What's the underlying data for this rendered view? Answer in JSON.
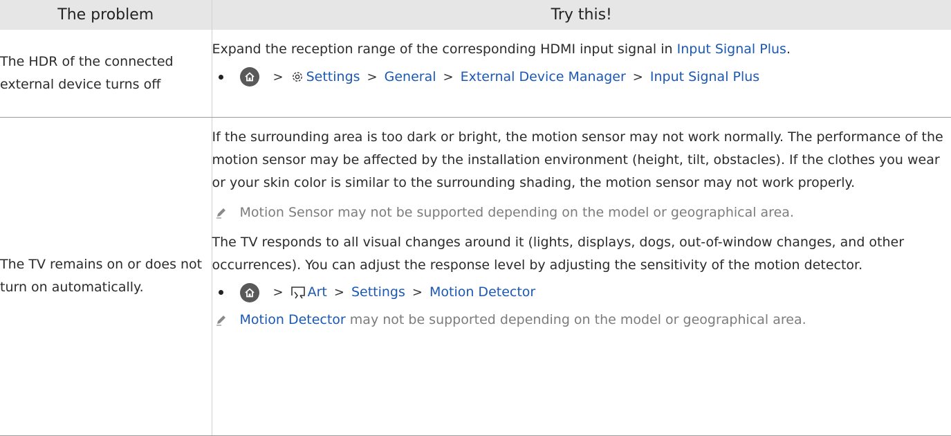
{
  "headers": {
    "problem": "The problem",
    "try": "Try this!"
  },
  "row1": {
    "problem": "The HDR of the connected external device turns off",
    "text_before": "Expand the reception range of the corresponding HDMI input signal in ",
    "text_link": "Input Signal Plus",
    "text_after": ".",
    "path": [
      "Settings",
      "General",
      "External Device Manager",
      "Input Signal Plus"
    ]
  },
  "row2": {
    "problem": "The TV remains on or does not turn on automatically.",
    "para1": "If the surrounding area is too dark or bright, the motion sensor may not work normally. The performance of the motion sensor may be affected by the installation environment (height, tilt, obstacles). If the clothes you wear or your skin color is similar to the surrounding shading, the motion sensor may not work properly.",
    "note1": "Motion Sensor may not be supported depending on the model or geographical area.",
    "para2": "The TV responds to all visual changes around it (lights, displays, dogs, out-of-window changes, and other occurrences). You can adjust the response level by adjusting the sensitivity of the motion detector.",
    "path": [
      "Art",
      "Settings",
      "Motion Detector"
    ],
    "note2_link": "Motion Detector",
    "note2_rest": " may not be supported depending on the model or geographical area."
  },
  "icons": [
    "home-icon",
    "chevron-right-icon",
    "gear-icon",
    "art-mode-icon",
    "pencil-note-icon"
  ],
  "colors": {
    "link": "#1a58b4",
    "header_bg": "#e6e6e6",
    "note_text": "#7c7c7c"
  }
}
